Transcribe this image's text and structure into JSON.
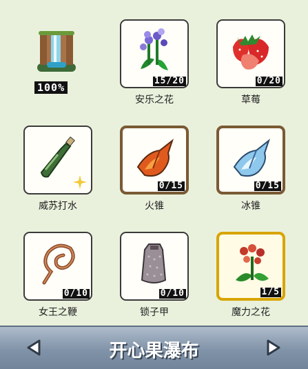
{
  "waterfall": {
    "percent": "100%",
    "icon": "waterfall-icon"
  },
  "items": [
    {
      "name": "安乐之花",
      "count": "15/20",
      "icon": "lavender-flower-icon"
    },
    {
      "name": "草莓",
      "count": "0/20",
      "icon": "strawberry-icon"
    },
    {
      "name": "威苏打水",
      "count": "",
      "icon": "soda-bottle-icon"
    },
    {
      "name": "火锥",
      "count": "0/15",
      "icon": "fire-cone-icon"
    },
    {
      "name": "冰锥",
      "count": "0/15",
      "icon": "ice-cone-icon"
    },
    {
      "name": "女王之鞭",
      "count": "0/10",
      "icon": "queen-whip-icon"
    },
    {
      "name": "锁子甲",
      "count": "0/10",
      "icon": "chainmail-icon"
    },
    {
      "name": "魔力之花",
      "count": "1/5",
      "icon": "magic-flower-icon"
    }
  ],
  "footer": {
    "title": "开心果瀑布",
    "prev_icon": "left-arrow-icon",
    "next_icon": "right-arrow-icon"
  },
  "colors": {
    "background": "#e9f1dc",
    "footer": "#8193a8",
    "brown_border": "#7a5a34",
    "gold_border": "#d8a400"
  }
}
